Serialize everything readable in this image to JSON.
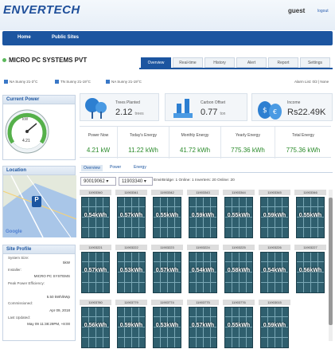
{
  "header": {
    "logo": "ENVERTECH",
    "user": "guest",
    "logout": "logout"
  },
  "nav": {
    "home": "Home",
    "public_sites": "Public Sites"
  },
  "site": {
    "name": "MICRO PC SYSTEMS PVT"
  },
  "tabs": [
    "Overview",
    "Real-time",
    "History",
    "Alert",
    "Report",
    "Settings"
  ],
  "legend": {
    "items": [
      "NA Sunny 21-3°C",
      "TN Sunny 21-19°C",
      "NA Sunny 21-19°C"
    ],
    "right": "Alarm List: 0/2 | None"
  },
  "current_power": {
    "title": "Current Power",
    "value": "4.21",
    "unit": "kW",
    "min": "0",
    "max": "kW"
  },
  "stats": [
    {
      "label": "Trees Planted",
      "value": "2.12",
      "unit": "trees"
    },
    {
      "label": "Carbon Offset",
      "value": "0.77",
      "unit": "ton"
    },
    {
      "label": "Income",
      "value": "Rs22.49K",
      "unit": ""
    }
  ],
  "energy": [
    {
      "label": "Power Now",
      "value": "4.21 kW"
    },
    {
      "label": "Today's Energy",
      "value": "11.22 kWh"
    },
    {
      "label": "Monthly Energy",
      "value": "41.72 kWh"
    },
    {
      "label": "Yearly Energy",
      "value": "775.36 kWh"
    },
    {
      "label": "Total Energy",
      "value": "775.36 kWh"
    }
  ],
  "location": {
    "title": "Location",
    "map_text": "Google"
  },
  "site_profile": {
    "title": "Site Profile",
    "rows": [
      {
        "label": "System Size:",
        "value": "5kW"
      },
      {
        "label": "Installer:",
        "value": "MICRO PC SYSTEMS"
      },
      {
        "label": "Peak Power Efficiency:",
        "value": "5.50 kWh/kWp"
      },
      {
        "label": "Commissioned:",
        "value": "Apr 09, 2018"
      },
      {
        "label": "Last Updated:",
        "value": "May 09 11:38:29PM, +8:00"
      }
    ]
  },
  "subtabs": [
    "Overview",
    "Power",
    "Energy"
  ],
  "selectors": {
    "group": "90019062",
    "device": "11903340"
  },
  "filter_text": "EnvirBridge: 1   Online: 1   Inverters: 20   Online: 20",
  "panels": [
    {
      "id": "11903340",
      "value": "0.54kWh"
    },
    {
      "id": "11903341",
      "value": "0.57kWh"
    },
    {
      "id": "11903342",
      "value": "0.55kWh"
    },
    {
      "id": "11903343",
      "value": "0.59kWh"
    },
    {
      "id": "11903344",
      "value": "0.55kWh"
    },
    {
      "id": "11903345",
      "value": "0.59kWh"
    },
    {
      "id": "11903346",
      "value": "0.55kWh"
    },
    {
      "id": "11903221",
      "value": "0.57kWh"
    },
    {
      "id": "11903222",
      "value": "0.53kWh"
    },
    {
      "id": "11903223",
      "value": "0.57kWh"
    },
    {
      "id": "11903224",
      "value": "0.54kWh"
    },
    {
      "id": "11903225",
      "value": "0.58kWh"
    },
    {
      "id": "11903226",
      "value": "0.54kWh"
    },
    {
      "id": "11903227",
      "value": "0.56kWh"
    },
    {
      "id": "11903780",
      "value": "0.56kWh"
    },
    {
      "id": "11903779",
      "value": "0.59kWh"
    },
    {
      "id": "11903774",
      "value": "0.53kWh"
    },
    {
      "id": "11903775",
      "value": "0.57kWh"
    },
    {
      "id": "11903776",
      "value": "0.55kWh"
    },
    {
      "id": "11903015",
      "value": "0.59kWh"
    }
  ]
}
